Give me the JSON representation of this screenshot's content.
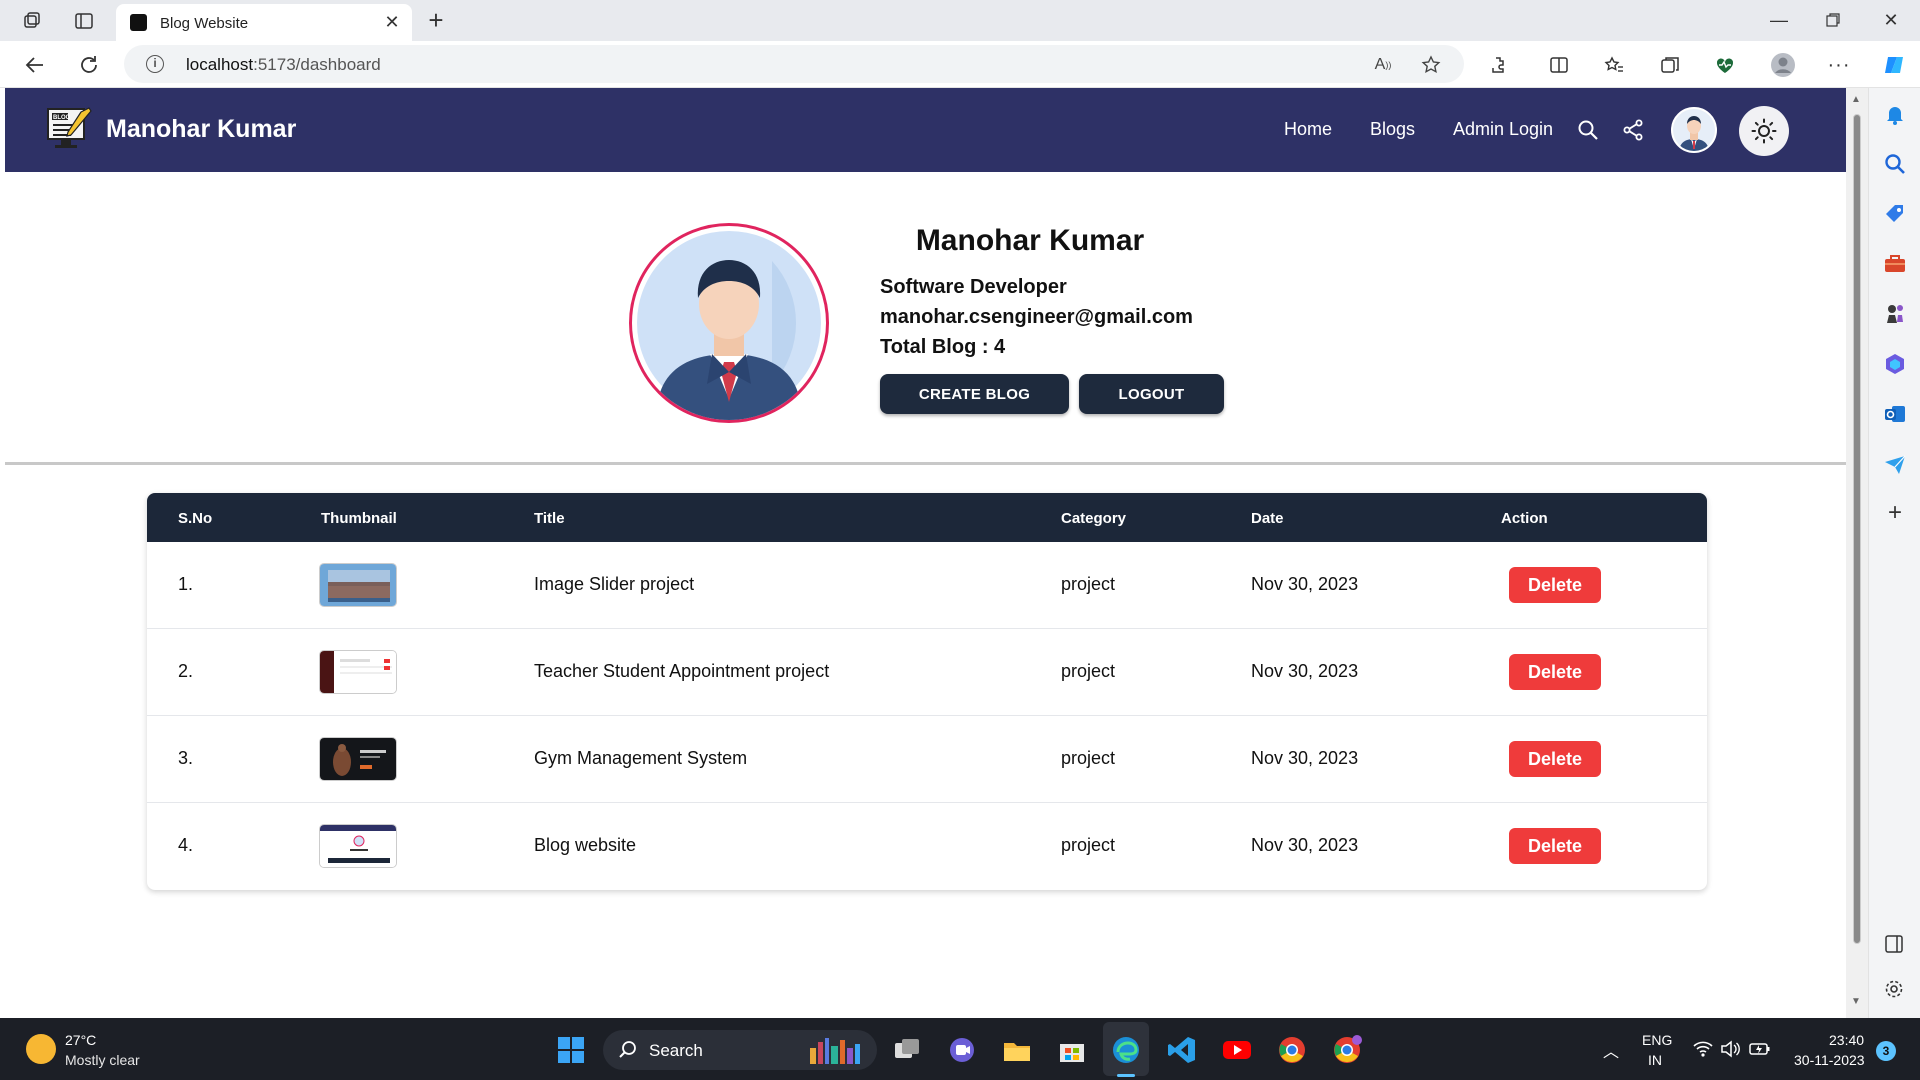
{
  "browser": {
    "tab_title": "Blog Website",
    "url_host": "localhost",
    "url_rest": ":5173/dashboard"
  },
  "site": {
    "brand": "Manohar Kumar",
    "nav": {
      "home": "Home",
      "blogs": "Blogs",
      "admin_login": "Admin Login"
    }
  },
  "profile": {
    "name": "Manohar Kumar",
    "role": "Software Developer",
    "email": "manohar.csengineer@gmail.com",
    "total_blog": "Total Blog : 4",
    "create_label": "CREATE BLOG",
    "logout_label": "LOGOUT"
  },
  "table": {
    "headers": [
      "S.No",
      "Thumbnail",
      "Title",
      "Category",
      "Date",
      "Action"
    ],
    "rows": [
      {
        "sno": "1.",
        "title": "Image Slider project",
        "category": "project",
        "date": "Nov 30, 2023",
        "action": "Delete"
      },
      {
        "sno": "2.",
        "title": "Teacher Student Appointment project",
        "category": "project",
        "date": "Nov 30, 2023",
        "action": "Delete"
      },
      {
        "sno": "3.",
        "title": "Gym Management System",
        "category": "project",
        "date": "Nov 30, 2023",
        "action": "Delete"
      },
      {
        "sno": "4.",
        "title": "Blog website",
        "category": "project",
        "date": "Nov 30, 2023",
        "action": "Delete"
      }
    ]
  },
  "taskbar": {
    "temperature": "27°C",
    "condition": "Mostly clear",
    "search_label": "Search",
    "lang": "ENG",
    "region": "IN",
    "time": "23:40",
    "date": "30-11-2023",
    "notification_count": "3"
  },
  "colors": {
    "navbar": "#2e3166",
    "table_header": "#1c2739",
    "delete_button": "#ef3b3b",
    "profile_ring": "#e0245e",
    "primary_button": "#1e2a3d"
  }
}
